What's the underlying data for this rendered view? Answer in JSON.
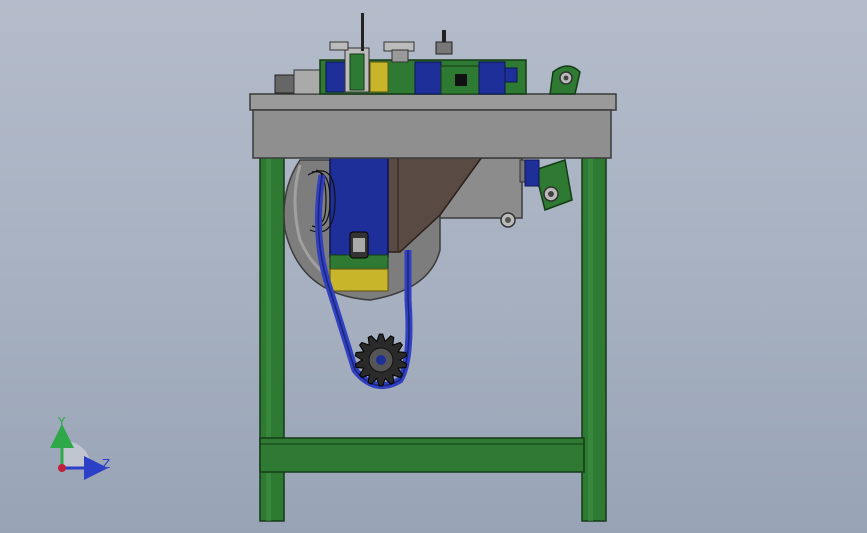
{
  "view": {
    "background_top": "#b4bccb",
    "background_bottom": "#98a3b6"
  },
  "triad": {
    "y_label": "Y",
    "z_label": "Z",
    "y_color": "#2fa84a",
    "z_color": "#2c3fc7",
    "origin_color": "#c0203a"
  },
  "colors": {
    "frame_green": "#2f7a32",
    "table_gray": "#9a9a9a",
    "blue_part": "#1f2f9a",
    "belt_blue": "#3140c0",
    "brown_housing": "#5a4a44",
    "yellow_part": "#c9b52a"
  }
}
